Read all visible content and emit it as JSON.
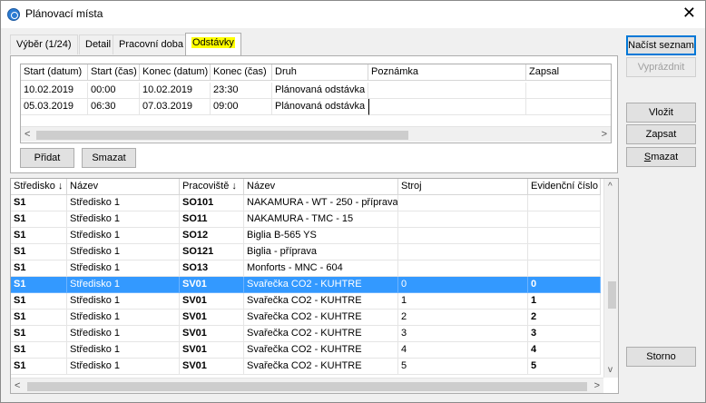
{
  "window": {
    "title": "Plánovací místa",
    "close_glyph": "✕"
  },
  "tabs": [
    {
      "label": "Výběr (1/24)"
    },
    {
      "label": "Detail"
    },
    {
      "label": "Pracovní doba"
    },
    {
      "label": "Odstávky"
    }
  ],
  "active_tab": "Odstávky",
  "outages": {
    "columns": [
      "Start (datum)",
      "Start (čas)",
      "Konec (datum)",
      "Konec (čas)",
      "Druh",
      "Poznámka",
      "Zapsal"
    ],
    "rows": [
      [
        "10.02.2019",
        "00:00",
        "10.02.2019",
        "23:30",
        "Plánovaná odstávka",
        "",
        ""
      ],
      [
        "05.03.2019",
        "06:30",
        "07.03.2019",
        "09:00",
        "Plánovaná odstávka",
        "",
        ""
      ]
    ],
    "add_label": "Přidat",
    "delete_label": "Smazat"
  },
  "sidebar_buttons": {
    "load_list": "Načíst seznam",
    "clear": "Vyprázdnit",
    "insert": "Vložit",
    "record": "Zapsat",
    "delete_prefix": "",
    "delete_underlined": "S",
    "delete_rest": "mazat",
    "cancel": "Storno"
  },
  "workplaces": {
    "columns": [
      "Středisko ↓",
      "Název",
      "Pracoviště ↓",
      "Název",
      "Stroj",
      "Evidenční číslo"
    ],
    "rows": [
      [
        "S1",
        "Středisko 1",
        "SO101",
        "NAKAMURA - WT - 250 - příprava",
        "",
        ""
      ],
      [
        "S1",
        "Středisko 1",
        "SO11",
        "NAKAMURA - TMC - 15",
        "",
        ""
      ],
      [
        "S1",
        "Středisko 1",
        "SO12",
        "Biglia B-565 YS",
        "",
        ""
      ],
      [
        "S1",
        "Středisko 1",
        "SO121",
        "Biglia - příprava",
        "",
        ""
      ],
      [
        "S1",
        "Středisko 1",
        "SO13",
        "Monforts - MNC - 604",
        "",
        ""
      ],
      [
        "S1",
        "Středisko 1",
        "SV01",
        "Svařečka CO2 - KUHTRE",
        "0",
        "0"
      ],
      [
        "S1",
        "Středisko 1",
        "SV01",
        "Svařečka CO2 - KUHTRE",
        "1",
        "1"
      ],
      [
        "S1",
        "Středisko 1",
        "SV01",
        "Svařečka CO2 - KUHTRE",
        "2",
        "2"
      ],
      [
        "S1",
        "Středisko 1",
        "SV01",
        "Svařečka CO2 - KUHTRE",
        "3",
        "3"
      ],
      [
        "S1",
        "Středisko 1",
        "SV01",
        "Svařečka CO2 - KUHTRE",
        "4",
        "4"
      ],
      [
        "S1",
        "Středisko 1",
        "SV01",
        "Svařečka CO2 - KUHTRE",
        "5",
        "5"
      ]
    ],
    "selected_index": 5
  },
  "icons": {
    "app": "planning-app-icon",
    "close": "close-icon",
    "left": "◀",
    "right": "▶",
    "up": "▲",
    "down": "▼",
    "left_small": "<",
    "right_small": ">",
    "up_small": "^",
    "down_small": "v"
  },
  "colors": {
    "selection": "#3399ff",
    "tab_highlight": "#ffff00",
    "primary_border": "#0078d7"
  }
}
